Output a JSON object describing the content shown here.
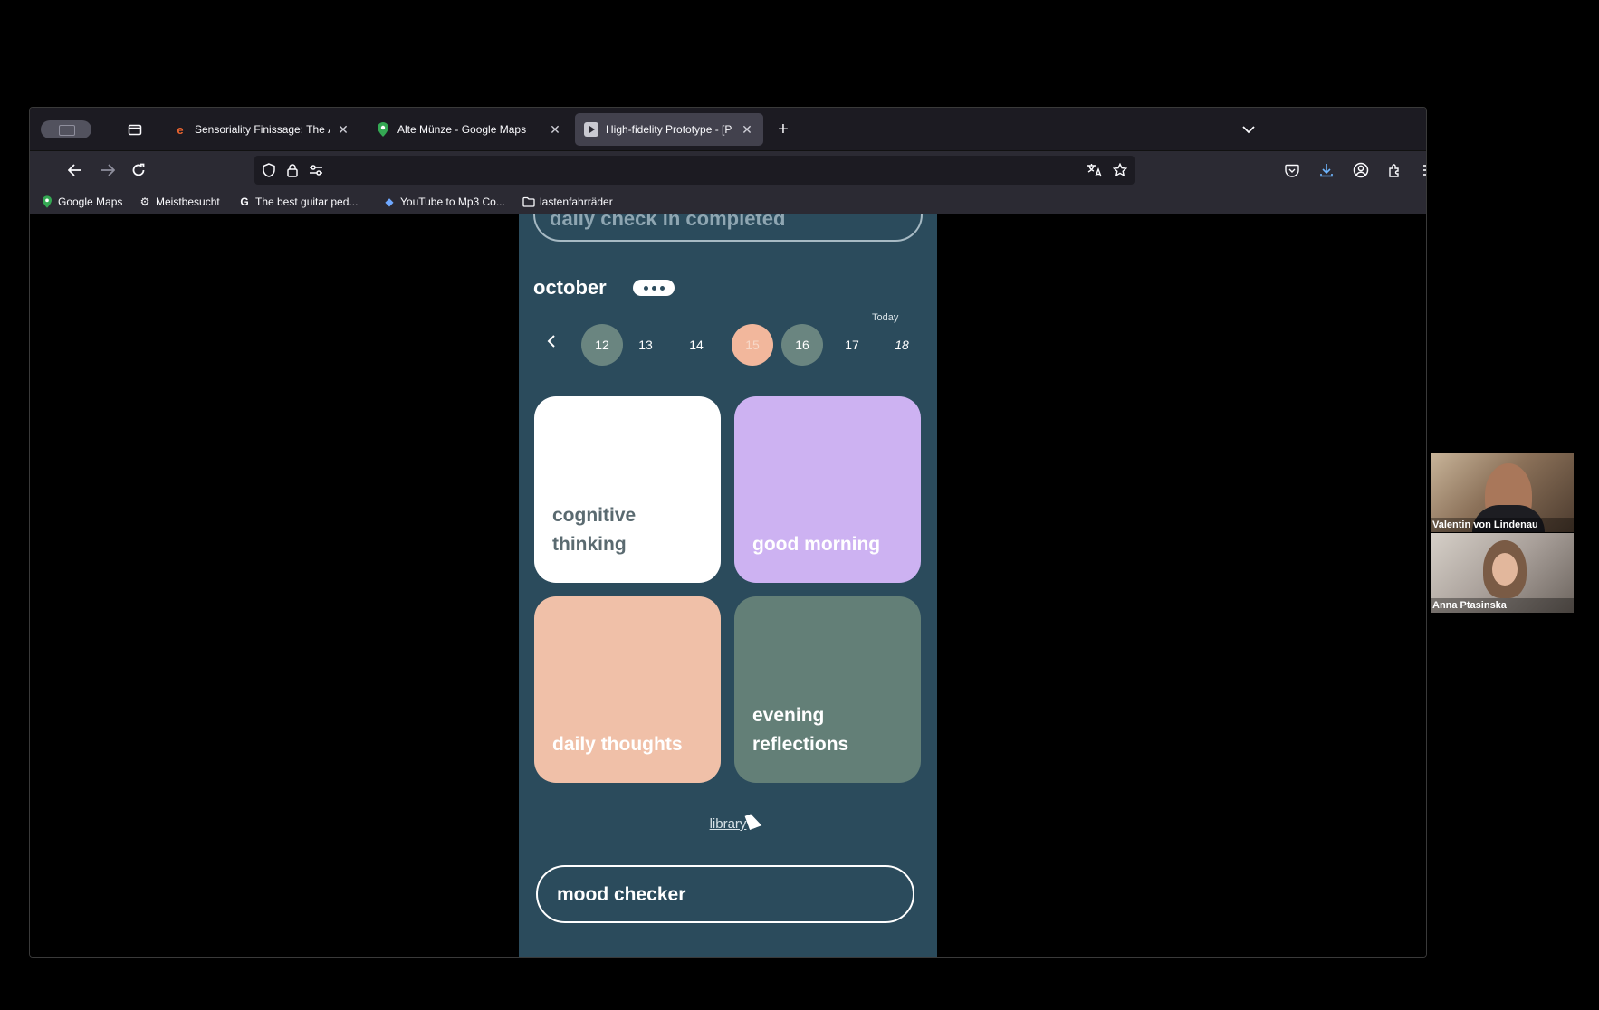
{
  "browser": {
    "tabs": [
      {
        "label": "Sensoriality Finissage: The Ága",
        "favicon": "e",
        "active": false
      },
      {
        "label": "Alte Münze - Google Maps",
        "favicon": "map-pin",
        "active": false
      },
      {
        "label": "High-fidelity Prototype - [P",
        "favicon": "play",
        "active": true
      }
    ],
    "new_tab": "+",
    "bookmarks": [
      {
        "label": "Google Maps",
        "icon": "map-pin-icon"
      },
      {
        "label": "Meistbesucht",
        "icon": "gear-icon"
      },
      {
        "label": "The best guitar ped...",
        "icon": "g-icon"
      },
      {
        "label": "YouTube to Mp3 Co...",
        "icon": "diamond-icon"
      },
      {
        "label": "lastenfahrräder",
        "icon": "folder-icon"
      }
    ]
  },
  "app": {
    "top_banner": "daily check in completed",
    "month": "october",
    "today_label": "Today",
    "days": [
      "12",
      "13",
      "14",
      "15",
      "16",
      "17",
      "18"
    ],
    "cards": [
      {
        "label": "cognitive thinking",
        "color": "#ffffff"
      },
      {
        "label": "good morning",
        "color": "#cdb2f2"
      },
      {
        "label": "daily thoughts",
        "color": "#f0c0a8"
      },
      {
        "label": "evening reflections",
        "color": "#637f77"
      }
    ],
    "library": "library",
    "mood_checker": "mood checker",
    "background": "#2b4b5c",
    "accent_today": "#f2b79c"
  },
  "call": {
    "participants": [
      "Valentin von Lindenau",
      "Anna Ptasinska"
    ]
  }
}
